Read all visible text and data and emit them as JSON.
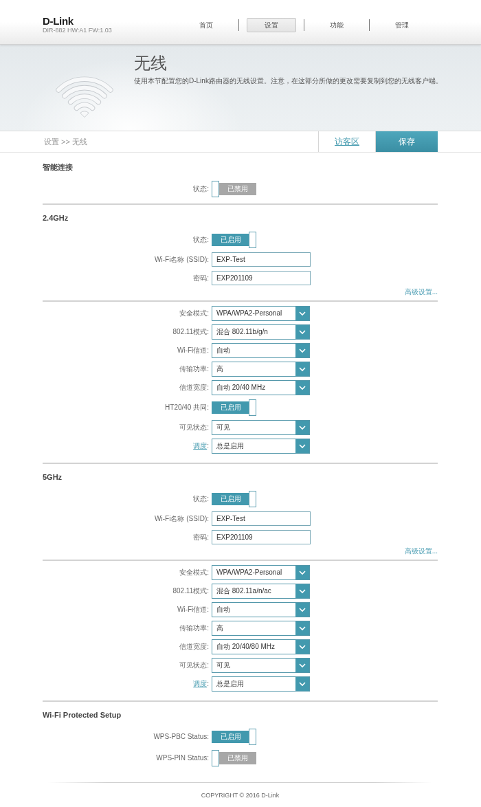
{
  "header": {
    "logo": "D-Link",
    "model": "DIR-882 HW:A1 FW:1.03",
    "nav": [
      {
        "label": "首页",
        "selected": false
      },
      {
        "label": "设置",
        "selected": true
      },
      {
        "label": "功能",
        "selected": false
      },
      {
        "label": "管理",
        "selected": false
      }
    ]
  },
  "banner": {
    "title": "无线",
    "description": "使用本节配置您的D-Link路由器的无线设置。注意，在这部分所做的更改需要复制到您的无线客户端。"
  },
  "breadcrumb": "设置 >> 无线",
  "actions": [
    {
      "label": "访客区",
      "kind": "link"
    },
    {
      "label": "保存",
      "kind": "primary"
    }
  ],
  "sections": [
    {
      "title": "智能连接",
      "rows": [
        {
          "kind": "toggle",
          "label": "状态:",
          "label_link": false,
          "on": false,
          "text": "已禁用"
        }
      ]
    },
    {
      "title": "2.4GHz",
      "rows": [
        {
          "kind": "toggle",
          "label": "状态:",
          "label_link": false,
          "on": true,
          "text": "已启用"
        },
        {
          "kind": "input",
          "label": "Wi-Fi名称 (SSID):",
          "label_link": false,
          "value": "EXP-Test"
        },
        {
          "kind": "input",
          "label": "密码:",
          "label_link": false,
          "value": "EXP201109"
        }
      ],
      "advanced_link": "高级设置...",
      "advanced_rows": [
        {
          "kind": "select",
          "label": "安全模式:",
          "label_link": false,
          "value": "WPA/WPA2-Personal"
        },
        {
          "kind": "select",
          "label": "802.11模式:",
          "label_link": false,
          "value": "混合 802.11b/g/n"
        },
        {
          "kind": "select",
          "label": "Wi-Fi信道:",
          "label_link": false,
          "value": "自动"
        },
        {
          "kind": "select",
          "label": "传输功率:",
          "label_link": false,
          "value": "高"
        },
        {
          "kind": "select",
          "label": "信道宽度:",
          "label_link": false,
          "value": "自动 20/40 MHz"
        },
        {
          "kind": "toggle",
          "label": "HT20/40 共同:",
          "label_link": false,
          "on": true,
          "text": "已启用"
        },
        {
          "kind": "select",
          "label": "可见状态:",
          "label_link": false,
          "value": "可见"
        },
        {
          "kind": "select",
          "label": "调度",
          "suffix": ":",
          "label_link": true,
          "value": "总是启用"
        }
      ]
    },
    {
      "title": "5GHz",
      "rows": [
        {
          "kind": "toggle",
          "label": "状态:",
          "label_link": false,
          "on": true,
          "text": "已启用"
        },
        {
          "kind": "input",
          "label": "Wi-Fi名称 (SSID):",
          "label_link": false,
          "value": "EXP-Test"
        },
        {
          "kind": "input",
          "label": "密码:",
          "label_link": false,
          "value": "EXP201109"
        }
      ],
      "advanced_link": "高级设置...",
      "advanced_rows": [
        {
          "kind": "select",
          "label": "安全模式:",
          "label_link": false,
          "value": "WPA/WPA2-Personal"
        },
        {
          "kind": "select",
          "label": "802.11模式:",
          "label_link": false,
          "value": "混合 802.11a/n/ac"
        },
        {
          "kind": "select",
          "label": "Wi-Fi信道:",
          "label_link": false,
          "value": "自动"
        },
        {
          "kind": "select",
          "label": "传输功率:",
          "label_link": false,
          "value": "高"
        },
        {
          "kind": "select",
          "label": "信道宽度:",
          "label_link": false,
          "value": "自动 20/40/80 MHz"
        },
        {
          "kind": "select",
          "label": "可见状态:",
          "label_link": false,
          "value": "可见"
        },
        {
          "kind": "select",
          "label": "调度",
          "suffix": ":",
          "label_link": true,
          "value": "总是启用"
        }
      ]
    },
    {
      "title": "Wi-Fi Protected Setup",
      "rows": [
        {
          "kind": "toggle",
          "label": "WPS-PBC Status:",
          "label_link": false,
          "on": true,
          "text": "已启用"
        },
        {
          "kind": "toggle",
          "label": "WPS-PIN Status:",
          "label_link": false,
          "on": false,
          "text": "已禁用"
        }
      ]
    }
  ],
  "footer": {
    "copyright": "COPYRIGHT © 2016 D-Link"
  }
}
